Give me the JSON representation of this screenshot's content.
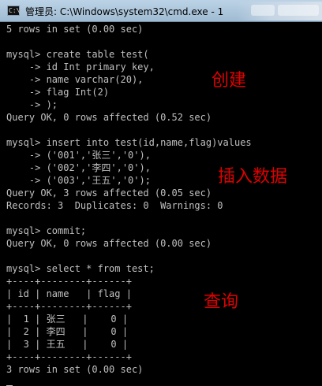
{
  "window": {
    "title": "管理员: C:\\Windows\\system32\\cmd.exe - 1",
    "icon": "cmd-icon"
  },
  "console": {
    "lines": [
      "5 rows in set (0.00 sec)",
      "",
      "mysql> create table test(",
      "    -> id Int primary key,",
      "    -> name varchar(20),",
      "    -> flag Int(2)",
      "    -> );",
      "Query OK, 0 rows affected (0.52 sec)",
      "",
      "mysql> insert into test(id,name,flag)values",
      "    -> ('001','张三','0'),",
      "    -> ('002','李四','0'),",
      "    -> ('003','王五','0');",
      "Query OK, 3 rows affected (0.05 sec)",
      "Records: 3  Duplicates: 0  Warnings: 0",
      "",
      "mysql> commit;",
      "Query OK, 0 rows affected (0.00 sec)",
      "",
      "mysql> select * from test;",
      "+----+--------+------+",
      "| id | name   | flag |",
      "+----+--------+------+",
      "|  1 | 张三   |    0 |",
      "|  2 | 李四   |    0 |",
      "|  3 | 王五   |    0 |",
      "+----+--------+------+",
      "3 rows in set (0.00 sec)"
    ]
  },
  "annotations": {
    "create": "创建",
    "insert": "插入数据",
    "query": "查询",
    "color": "#e00000"
  }
}
